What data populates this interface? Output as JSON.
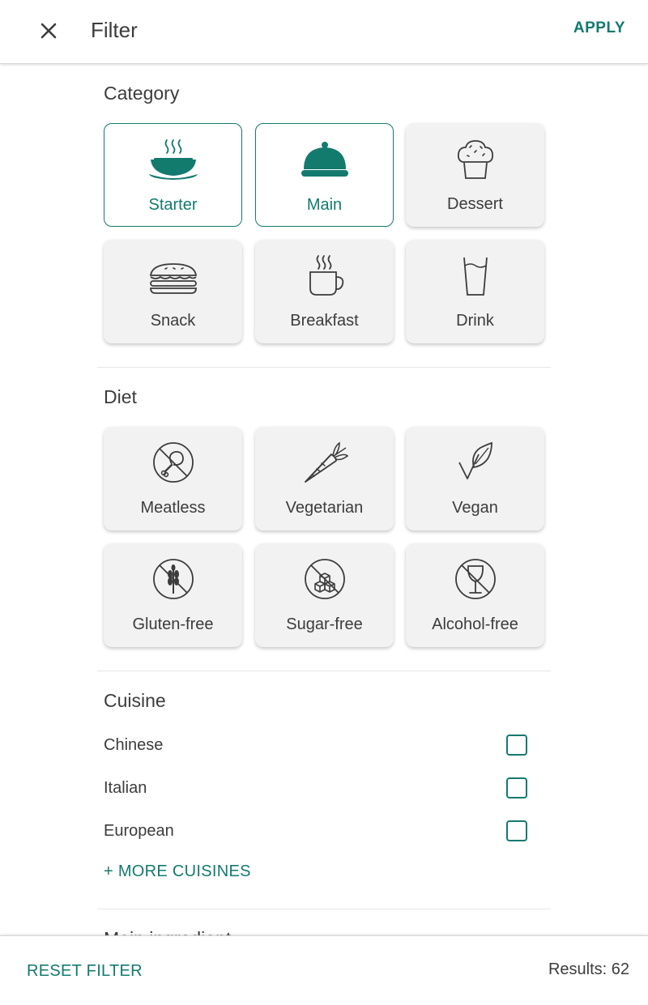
{
  "header": {
    "title": "Filter",
    "apply_label": "APPLY",
    "close_icon": "close-icon"
  },
  "colors": {
    "accent": "#137a6e",
    "tile_bg": "#f2f2f2",
    "text": "#3c3c3c"
  },
  "category": {
    "title": "Category",
    "items": [
      {
        "label": "Starter",
        "icon": "soup-bowl-icon",
        "selected": true
      },
      {
        "label": "Main",
        "icon": "cloche-icon",
        "selected": true
      },
      {
        "label": "Dessert",
        "icon": "cupcake-icon",
        "selected": false
      },
      {
        "label": "Snack",
        "icon": "sandwich-icon",
        "selected": false
      },
      {
        "label": "Breakfast",
        "icon": "coffee-cup-icon",
        "selected": false
      },
      {
        "label": "Drink",
        "icon": "glass-icon",
        "selected": false
      }
    ]
  },
  "diet": {
    "title": "Diet",
    "items": [
      {
        "label": "Meatless",
        "icon": "no-meat-icon",
        "selected": false
      },
      {
        "label": "Vegetarian",
        "icon": "carrot-icon",
        "selected": false
      },
      {
        "label": "Vegan",
        "icon": "leaf-icon",
        "selected": false
      },
      {
        "label": "Gluten-free",
        "icon": "no-wheat-icon",
        "selected": false
      },
      {
        "label": "Sugar-free",
        "icon": "no-sugar-icon",
        "selected": false
      },
      {
        "label": "Alcohol-free",
        "icon": "no-alcohol-icon",
        "selected": false
      }
    ]
  },
  "cuisine": {
    "title": "Cuisine",
    "items": [
      {
        "label": "Chinese",
        "checked": false
      },
      {
        "label": "Italian",
        "checked": false
      },
      {
        "label": "European",
        "checked": false
      }
    ],
    "more_label": "+ MORE CUISINES"
  },
  "next_section": {
    "title": "Main ingredient"
  },
  "footer": {
    "reset_label": "RESET FILTER",
    "results_text": "Results: 62"
  }
}
